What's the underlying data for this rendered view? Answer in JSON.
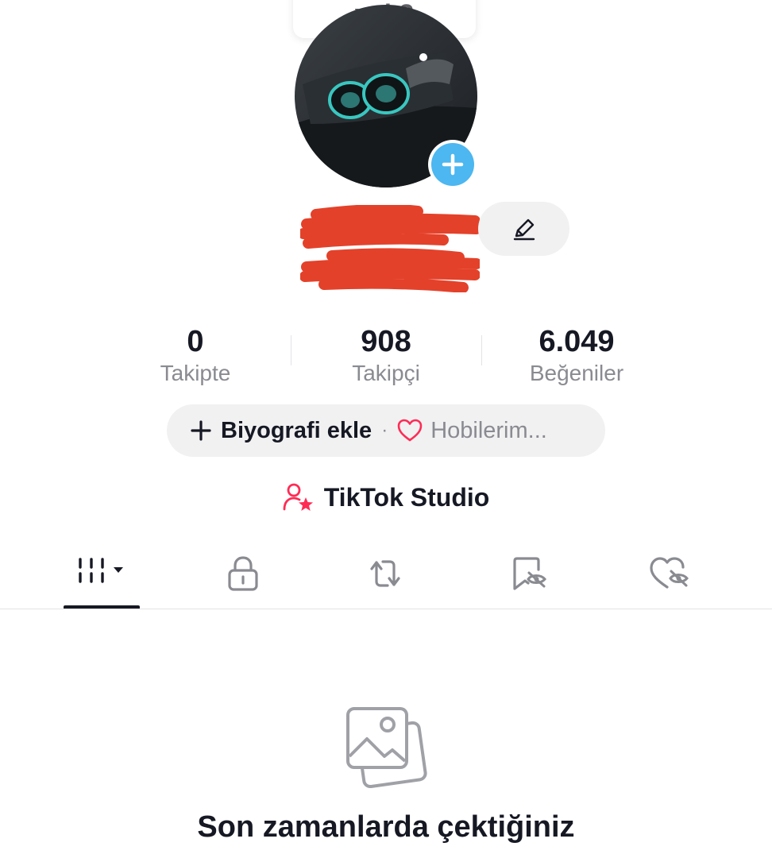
{
  "tooltip": {
    "text": "yok?"
  },
  "profile": {
    "edit_icon": "pencil-icon",
    "add_avatar_icon": "plus-icon"
  },
  "stats": [
    {
      "value": "0",
      "label": "Takipte"
    },
    {
      "value": "908",
      "label": "Takipçi"
    },
    {
      "value": "6.049",
      "label": "Beğeniler"
    }
  ],
  "bio": {
    "add_label": "Biyografi ekle",
    "separator": "·",
    "hobbies_label": "Hobilerim..."
  },
  "studio": {
    "label": "TikTok Studio"
  },
  "tabs": [
    {
      "name": "videos",
      "icon": "grid-icon",
      "active": true
    },
    {
      "name": "private",
      "icon": "lock-icon",
      "active": false
    },
    {
      "name": "reposts",
      "icon": "repost-icon",
      "active": false
    },
    {
      "name": "favorites",
      "icon": "bookmark-hidden-icon",
      "active": false
    },
    {
      "name": "liked",
      "icon": "heart-hidden-icon",
      "active": false
    }
  ],
  "empty_state": {
    "icon": "photos-icon",
    "title": "Son zamanlarda çektiğiniz"
  },
  "colors": {
    "accent_blue": "#4cb7f0",
    "heart_red": "#fe2c55",
    "text_dark": "#161823",
    "text_gray": "#8a8b91",
    "pill_bg": "#f1f1f2"
  }
}
